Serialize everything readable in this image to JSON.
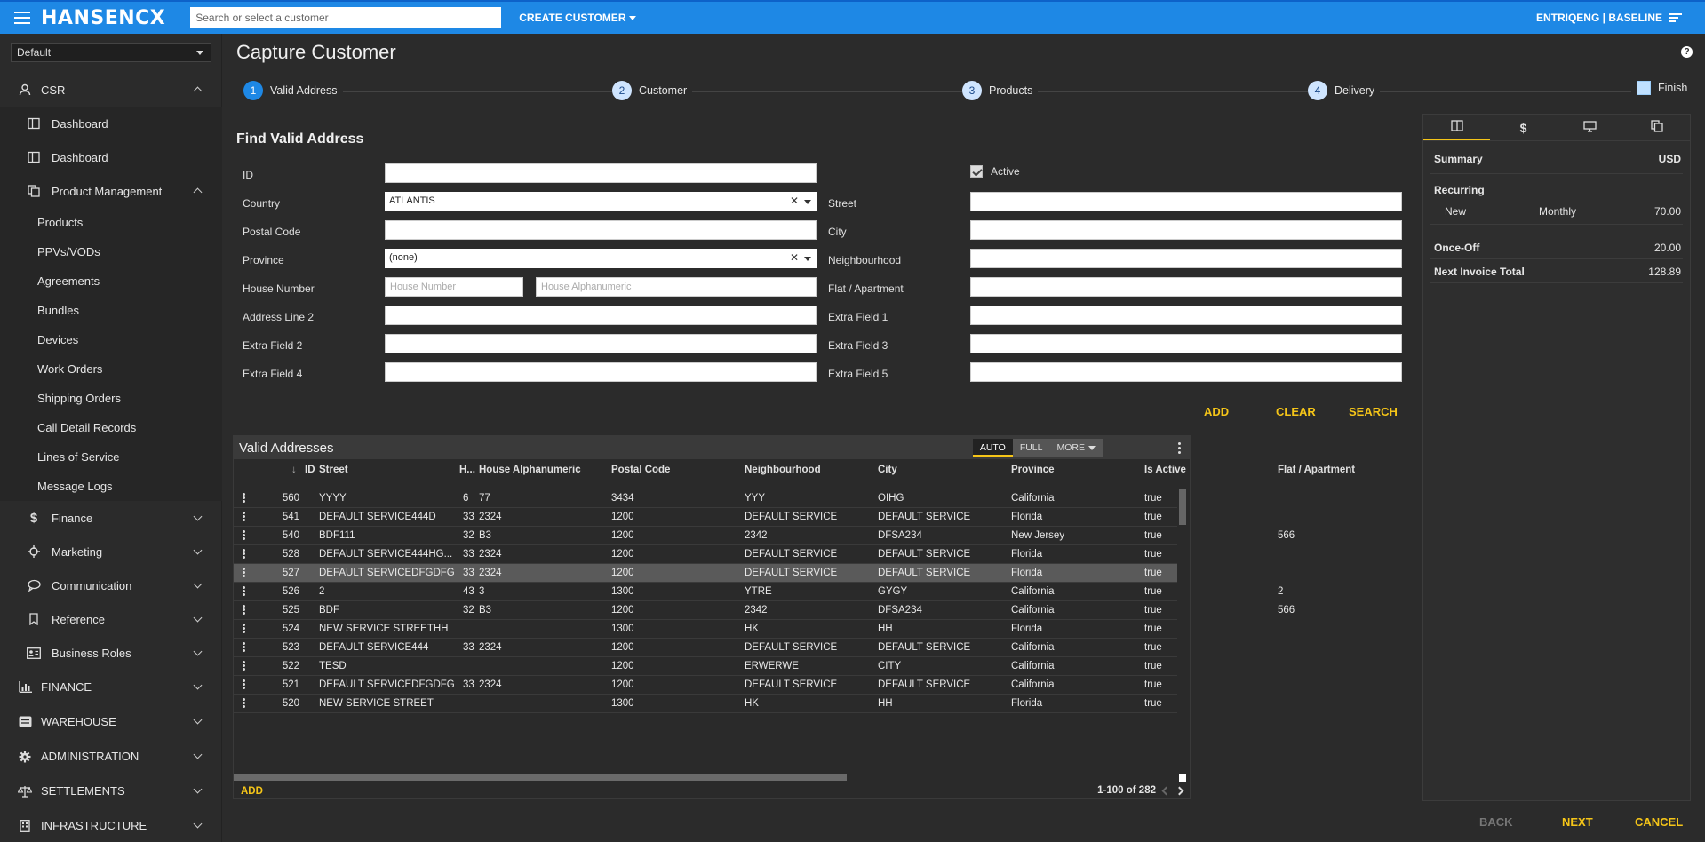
{
  "topbar": {
    "logo": "HANSENCX",
    "search_placeholder": "Search or select a customer",
    "create_customer": "CREATE CUSTOMER",
    "user_context": "ENTRIQENG | BASELINE"
  },
  "sidebar": {
    "profile": "Default",
    "csr": "CSR",
    "dashboard1": "Dashboard",
    "dashboard2": "Dashboard",
    "product_management": "Product Management",
    "pm_items": [
      "Products",
      "PPVs/VODs",
      "Agreements",
      "Bundles",
      "Devices",
      "Work Orders",
      "Shipping Orders",
      "Call Detail Records",
      "Lines of Service",
      "Message Logs"
    ],
    "finance": "Finance",
    "marketing": "Marketing",
    "communication": "Communication",
    "reference": "Reference",
    "business_roles": "Business Roles",
    "finance_top": "FINANCE",
    "warehouse": "WAREHOUSE",
    "administration": "ADMINISTRATION",
    "settlements": "SETTLEMENTS",
    "infrastructure": "INFRASTRUCTURE"
  },
  "page": {
    "title": "Capture Customer",
    "help": "?"
  },
  "stepper": {
    "steps": [
      {
        "num": "1",
        "label": "Valid Address"
      },
      {
        "num": "2",
        "label": "Customer"
      },
      {
        "num": "3",
        "label": "Products"
      },
      {
        "num": "4",
        "label": "Delivery"
      }
    ],
    "finish": "Finish"
  },
  "form": {
    "title": "Find Valid Address",
    "labels": {
      "id": "ID",
      "country": "Country",
      "postal_code": "Postal Code",
      "province": "Province",
      "house_number": "House Number",
      "address_line2": "Address Line 2",
      "extra2": "Extra Field 2",
      "extra4": "Extra Field 4",
      "active": "Active",
      "street": "Street",
      "city": "City",
      "neighbourhood": "Neighbourhood",
      "flat": "Flat / Apartment",
      "extra1": "Extra Field 1",
      "extra3": "Extra Field 3",
      "extra5": "Extra Field 5"
    },
    "values": {
      "country": "ATLANTIS",
      "province": "(none)"
    },
    "placeholders": {
      "house_number": "House Number",
      "house_alpha": "House Alphanumeric"
    },
    "buttons": {
      "add": "ADD",
      "clear": "CLEAR",
      "search": "SEARCH"
    }
  },
  "grid": {
    "title": "Valid Addresses",
    "views": [
      "AUTO",
      "FULL",
      "MORE"
    ],
    "columns": [
      "ID",
      "Street",
      "H...",
      "House Alphanumeric",
      "Postal Code",
      "Neighbourhood",
      "City",
      "Province",
      "Is Active",
      "Flat / Apartment"
    ],
    "rows": [
      [
        "560",
        "YYYY",
        "6",
        "77",
        "3434",
        "YYY",
        "OIHG",
        "California",
        "true",
        ""
      ],
      [
        "541",
        "DEFAULT SERVICE444D",
        "33",
        "2324",
        "1200",
        "DEFAULT SERVICE",
        "DEFAULT SERVICE",
        "Florida",
        "true",
        ""
      ],
      [
        "540",
        "BDF111",
        "32",
        "B3",
        "1200",
        "2342",
        "DFSA234",
        "New Jersey",
        "true",
        "566"
      ],
      [
        "528",
        "DEFAULT SERVICE444HG...",
        "33",
        "2324",
        "1200",
        "DEFAULT SERVICE",
        "DEFAULT SERVICE",
        "Florida",
        "true",
        ""
      ],
      [
        "527",
        "DEFAULT SERVICEDFGDFG",
        "33",
        "2324",
        "1200",
        "DEFAULT SERVICE",
        "DEFAULT SERVICE",
        "Florida",
        "true",
        ""
      ],
      [
        "526",
        "2",
        "43",
        "3",
        "1300",
        "YTRE",
        "GYGY",
        "California",
        "true",
        "2"
      ],
      [
        "525",
        "BDF",
        "32",
        "B3",
        "1200",
        "2342",
        "DFSA234",
        "California",
        "true",
        "566"
      ],
      [
        "524",
        "NEW SERVICE STREETHH",
        "",
        "",
        "1300",
        "HK",
        "HH",
        "Florida",
        "true",
        ""
      ],
      [
        "523",
        "DEFAULT SERVICE444",
        "33",
        "2324",
        "1200",
        "DEFAULT SERVICE",
        "DEFAULT SERVICE",
        "California",
        "true",
        ""
      ],
      [
        "522",
        "TESD",
        "",
        "",
        "1200",
        "ERWERWE",
        "CITY",
        "California",
        "true",
        ""
      ],
      [
        "521",
        "DEFAULT SERVICEDFGDFG",
        "33",
        "2324",
        "1200",
        "DEFAULT SERVICE",
        "DEFAULT SERVICE",
        "California",
        "true",
        ""
      ],
      [
        "520",
        "NEW SERVICE STREET",
        "",
        "",
        "1300",
        "HK",
        "HH",
        "Florida",
        "true",
        ""
      ]
    ],
    "selected_row_index": 4,
    "add": "ADD",
    "pager": "1-100 of 282"
  },
  "summary": {
    "tabs": [
      "columns-icon",
      "dollar-icon",
      "monitor-icon",
      "copy-icon"
    ],
    "title": "Summary",
    "currency": "USD",
    "recurring": "Recurring",
    "rec_type": "New",
    "rec_period": "Monthly",
    "rec_amount": "70.00",
    "once_off": "Once-Off",
    "once_off_amount": "20.00",
    "next_invoice": "Next Invoice Total",
    "next_invoice_amount": "128.89"
  },
  "footer": {
    "back": "BACK",
    "next": "NEXT",
    "cancel": "CANCEL"
  },
  "colors": {
    "topbar": "#1e88e5",
    "accent": "#f5c518",
    "background": "#2b2b2b"
  }
}
